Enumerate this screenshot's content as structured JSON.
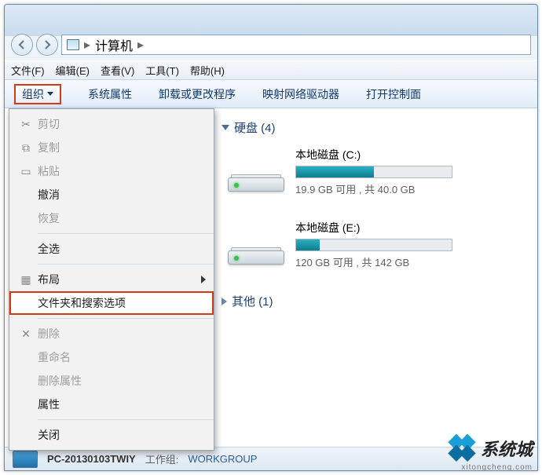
{
  "breadcrumb": {
    "root": "计算机"
  },
  "menubar": {
    "file": "文件(F)",
    "edit": "编辑(E)",
    "view": "查看(V)",
    "tools": "工具(T)",
    "help": "帮助(H)"
  },
  "toolbar": {
    "organize": "组织",
    "sysprops": "系统属性",
    "uninstall": "卸载或更改程序",
    "mapdrive": "映射网络驱动器",
    "controlpanel": "打开控制面"
  },
  "dropdown": {
    "cut": "剪切",
    "copy": "复制",
    "paste": "粘贴",
    "undo": "撤消",
    "redo": "恢复",
    "selectall": "全选",
    "layout": "布局",
    "folderopts": "文件夹和搜索选项",
    "delete": "删除",
    "rename": "重命名",
    "removeprops": "删除属性",
    "properties": "属性",
    "close": "关闭"
  },
  "sections": {
    "hdd": "硬盘 (4)",
    "other": "其他 (1)"
  },
  "drives": [
    {
      "name": "本地磁盘 (C:)",
      "free": "19.9 GB 可用 ,  共 40.0 GB",
      "fill": 50
    },
    {
      "name": "本地磁盘 (E:)",
      "free": "120 GB 可用 ,  共 142 GB",
      "fill": 15
    }
  ],
  "status": {
    "pc": "PC-20130103TWIY",
    "wg_label": "工作组:",
    "wg": "WORKGROUP"
  },
  "watermark": {
    "text": "系统城",
    "sub": "xitongcheng.com"
  }
}
